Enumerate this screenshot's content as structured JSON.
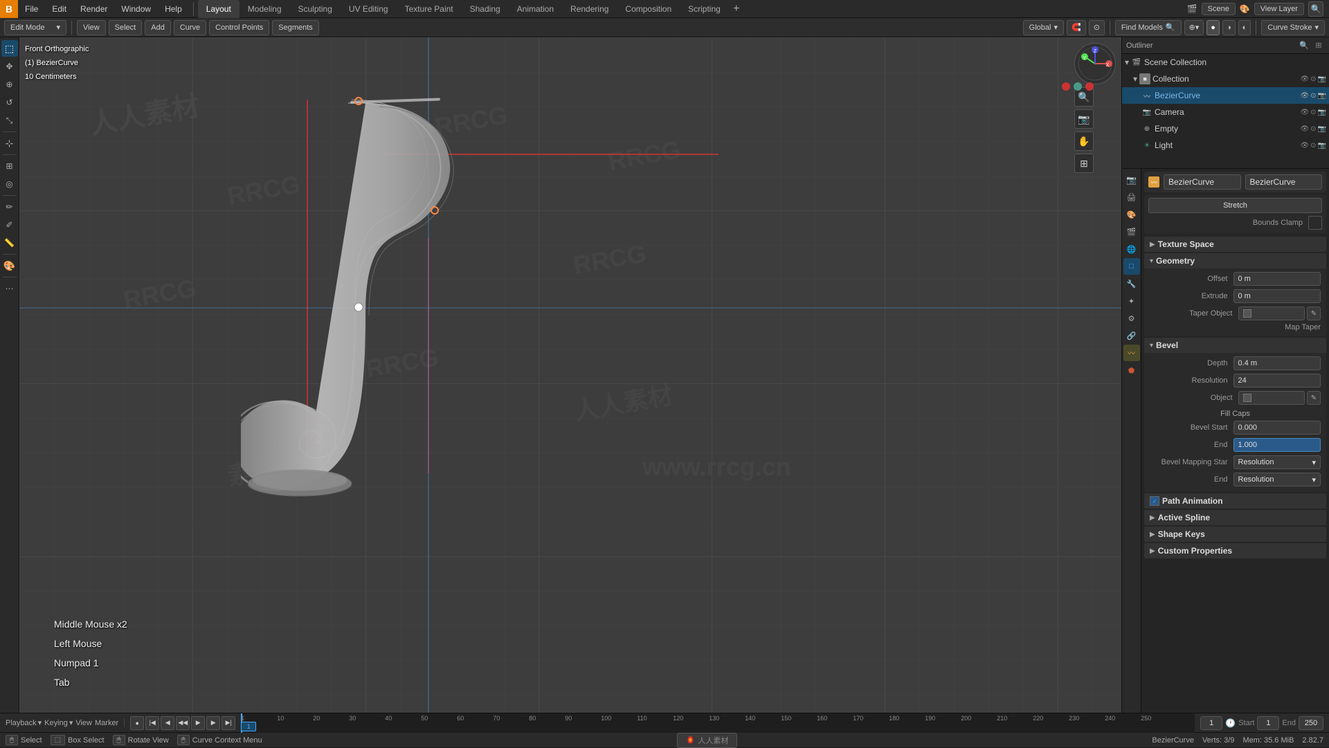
{
  "app": {
    "title": "Blender",
    "logo": "B",
    "view_layer": "View Layer"
  },
  "top_menu": {
    "items": [
      "File",
      "Edit",
      "Render",
      "Window",
      "Help"
    ],
    "workspace_tabs": [
      "Layout",
      "Modeling",
      "Sculpting",
      "UV Editing",
      "Texture Paint",
      "Shading",
      "Animation",
      "Rendering",
      "Composition",
      "Scripting"
    ],
    "active_workspace": "Layout",
    "scene_name": "Scene",
    "view_layer_name": "View Layer"
  },
  "second_toolbar": {
    "mode": "Edit Mode",
    "view_btn": "View",
    "select_btn": "Select",
    "add_btn": "Add",
    "curve_btn": "Curve",
    "control_points_btn": "Control Points",
    "segments_btn": "Segments",
    "global_select": "Global",
    "find_models": "Find Models"
  },
  "viewport": {
    "info_line1": "Front Orthographic",
    "info_line2": "(1) BezierCurve",
    "info_line3": "10 Centimeters",
    "cursor_style": "Curve Stroke"
  },
  "keylog": {
    "line1": "Middle Mouse x2",
    "line2": "Left Mouse",
    "line3": "Numpad 1",
    "line4": "Tab"
  },
  "outliner": {
    "title": "Outliner",
    "scene_collection": "Scene Collection",
    "collection": "Collection",
    "items": [
      {
        "name": "BezierCurve",
        "type": "curve",
        "selected": true,
        "indent": 2
      },
      {
        "name": "Camera",
        "type": "camera",
        "selected": false,
        "indent": 2
      },
      {
        "name": "Empty",
        "type": "empty",
        "selected": false,
        "indent": 2
      },
      {
        "name": "Light",
        "type": "light",
        "selected": false,
        "indent": 2
      }
    ]
  },
  "properties": {
    "object_name": "BezierCurve",
    "data_name": "BezierCurve",
    "stretch_label": "Stretch",
    "bounds_clamp_label": "Bounds Clamp",
    "sections": {
      "texture_space": "Texture Space",
      "geometry": "Geometry",
      "bevel": "Bevel",
      "path_animation": "Path Animation",
      "active_spline": "Active Spline",
      "shape_keys": "Shape Keys",
      "custom_properties": "Custom Properties"
    },
    "geometry": {
      "offset_label": "Offset",
      "offset_value": "0 m",
      "extrude_label": "Extrude",
      "extrude_value": "0 m",
      "taper_object_label": "Taper Object",
      "map_taper_label": "Map Taper"
    },
    "bevel": {
      "depth_label": "Depth",
      "depth_value": "0.4 m",
      "resolution_label": "Resolution",
      "resolution_value": "24",
      "object_label": "Object",
      "fill_caps_label": "Fill Caps",
      "bevel_start_label": "Bevel Start",
      "bevel_start_value": "0.000",
      "end_label": "End",
      "end_value": "1.000",
      "bevel_mapping_star_label": "Bevel Mapping Star",
      "bevel_mapping_end_label": "End",
      "resolution_dropdown": "Resolution",
      "resolution_dropdown_end": "Resolution"
    }
  },
  "timeline": {
    "start": "1",
    "end": "250",
    "current": "1",
    "markers": [
      1,
      10,
      20,
      30,
      40,
      50,
      60,
      70,
      80,
      90,
      100,
      110,
      120,
      130,
      140,
      150,
      160,
      170,
      180,
      190,
      200,
      210,
      220,
      230,
      240,
      250
    ]
  },
  "status_bar": {
    "select_label": "Select",
    "box_select_label": "Box Select",
    "rotate_view_label": "Rotate View",
    "curve_context_label": "Curve Context Menu",
    "object_info": "BezierCurve",
    "verts_info": "Verts: 3/9",
    "mem_info": "Mem: 35.6 MiB",
    "version": "2.82.7"
  },
  "colors": {
    "accent_blue": "#4a8aba",
    "active_blue": "#1a4a6a",
    "selected_highlight": "#4af0ff",
    "red_line": "#cc3333",
    "orange": "#e67e00",
    "teal": "#4a9a8a",
    "bg_dark": "#1a1a1a",
    "bg_medium": "#252525",
    "bg_light": "#3d3d3d"
  }
}
